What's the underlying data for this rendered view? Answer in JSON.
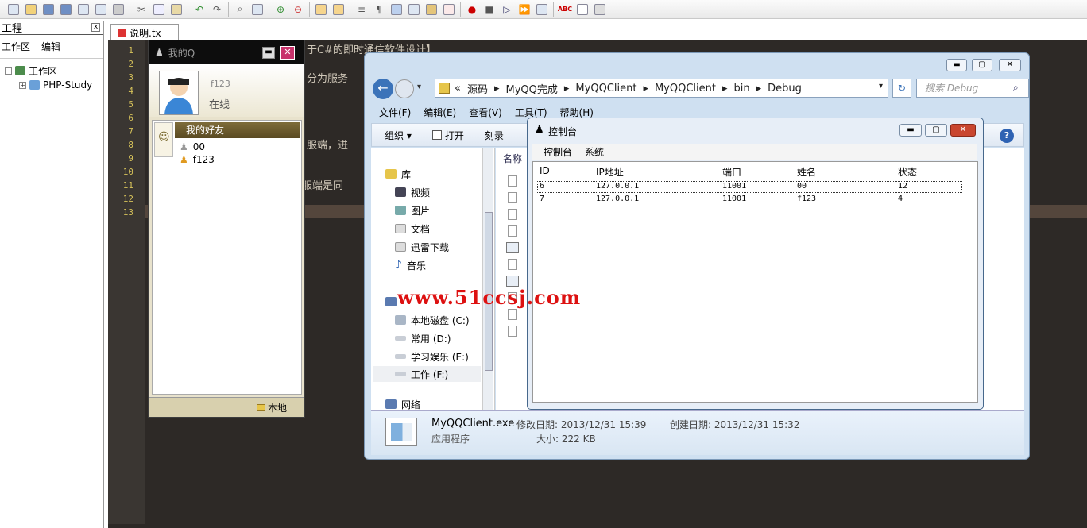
{
  "project_panel": {
    "title": "工程",
    "close": "x",
    "menu": [
      "工作区",
      "编辑"
    ],
    "tree": [
      "工作区",
      "PHP-Study"
    ]
  },
  "editor": {
    "tab_label": "说明.tx",
    "line_numbers": [
      "1",
      "2",
      "3",
      "4",
      "5",
      "6",
      "7",
      "8",
      "9",
      "10",
      "11",
      "12",
      "13"
    ],
    "fragments": [
      "于C#的即时通信软件设计】",
      "分为服务",
      "服端，进",
      "服端是同"
    ]
  },
  "qq": {
    "title": "我的Q",
    "min": "▬",
    "close": "✕",
    "username": "f123",
    "status": "在线",
    "group_label": "我的好友",
    "friends": [
      "00",
      "f123"
    ],
    "footer_label": "本地"
  },
  "explorer": {
    "breadcrumb": [
      "«",
      "源码",
      "MyQQ完成",
      "MyQQClient",
      "MyQQClient",
      "bin",
      "Debug"
    ],
    "search_placeholder": "搜索 Debug",
    "menu": [
      "文件(F)",
      "编辑(E)",
      "查看(V)",
      "工具(T)",
      "帮助(H)"
    ],
    "commands": [
      "组织 ▾",
      "打开",
      "刻录"
    ],
    "column_label": "名称",
    "nav": {
      "library": "库",
      "items": [
        "视频",
        "图片",
        "文档",
        "迅雷下载",
        "音乐"
      ],
      "computer_items": [
        "本地磁盘 (C:)",
        "常用 (D:)",
        "学习娱乐 (E:)",
        "工作 (F:)"
      ],
      "network": "网络"
    },
    "details": {
      "filename": "MyQQClient.exe",
      "type": "应用程序",
      "modified": "修改日期: 2013/12/31 15:39",
      "created": "创建日期: 2013/12/31 15:32",
      "size": "大小: 222 KB"
    }
  },
  "console": {
    "title": "控制台",
    "menu": [
      "控制台",
      "系统"
    ],
    "columns": [
      "ID",
      "IP地址",
      "端口",
      "姓名",
      "状态"
    ],
    "rows": [
      [
        "6",
        "127.0.0.1",
        "11001",
        "00",
        "12"
      ],
      [
        "7",
        "127.0.0.1",
        "11001",
        "f123",
        "4"
      ]
    ]
  },
  "watermark": "www.51ccsj.com",
  "colors": {
    "editor_bg": "#2d2926",
    "line_number": "#d6c25a",
    "qq_close": "#c8326b",
    "explorer_frame": "#cfe0f1",
    "watermark": "#dd1111"
  }
}
